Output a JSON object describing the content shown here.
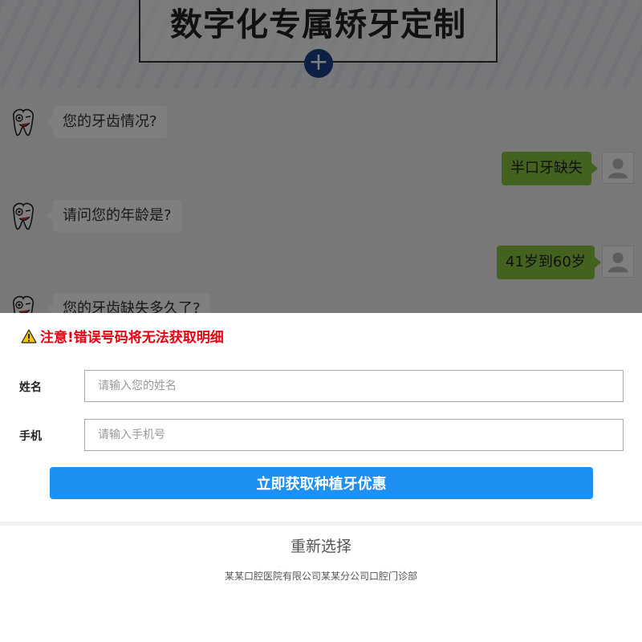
{
  "banner": {
    "title": "数字化专属矫牙定制",
    "plus_symbol": "+"
  },
  "chat": {
    "messages": [
      {
        "from": "bot",
        "text": "您的牙齿情况?"
      },
      {
        "from": "user",
        "text": "半口牙缺失"
      },
      {
        "from": "bot",
        "text": "请问您的年龄是?"
      },
      {
        "from": "user",
        "text": "41岁到60岁"
      },
      {
        "from": "bot",
        "text": "您的牙齿缺失多久了?"
      }
    ]
  },
  "form": {
    "warning": "注意!错误号码将无法获取明细",
    "name_label": "姓名",
    "name_placeholder": "请输入您的姓名",
    "name_value": "",
    "phone_label": "手机",
    "phone_placeholder": "请输入手机号",
    "phone_value": "",
    "submit_label": "立即获取种植牙优惠"
  },
  "reselect_label": "重新选择",
  "footer_text": "某某口腔医院有限公司某某分公司口腔门诊部",
  "colors": {
    "warning": "#e60012",
    "submit": "#1e8ff3",
    "user_bubble": "#86c43f",
    "plus_button": "#1c3f8a"
  },
  "icons": {
    "bot_avatar": "tooth-mascot-icon",
    "user_avatar": "user-silhouette-icon",
    "warning": "warning-triangle-icon"
  }
}
